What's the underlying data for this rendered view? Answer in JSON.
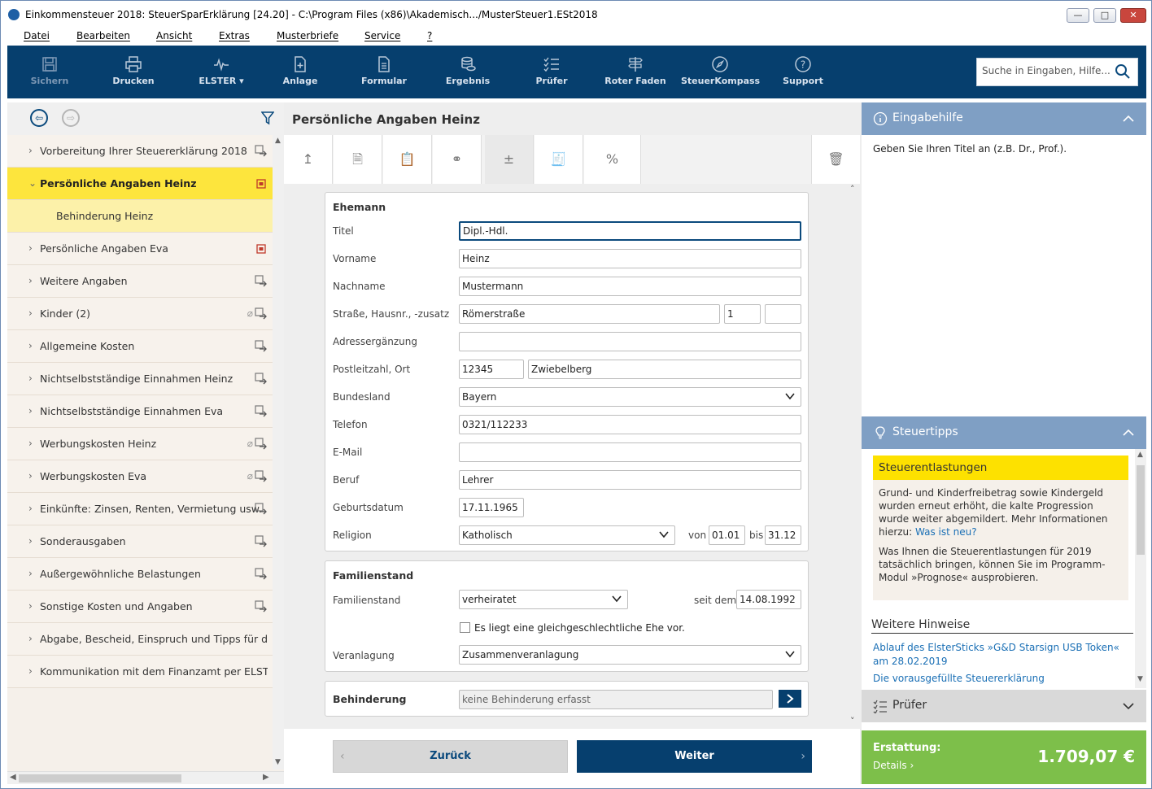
{
  "window": {
    "title": "Einkommensteuer 2018: SteuerSparErklärung [24.20] - C:\\Program Files (x86)\\Akademisch.../MusterSteuer1.ESt2018",
    "controls": {
      "minimize": "—",
      "maximize": "□",
      "close": "✕"
    }
  },
  "menu": [
    "Datei",
    "Bearbeiten",
    "Ansicht",
    "Extras",
    "Musterbriefe",
    "Service",
    "?"
  ],
  "toolbar": {
    "buttons": [
      {
        "label": "Sichern",
        "icon": "save-icon"
      },
      {
        "label": "Drucken",
        "icon": "printer-icon"
      },
      {
        "label": "ELSTER",
        "icon": "elster-icon"
      },
      {
        "label": "Anlage",
        "icon": "add-document-icon"
      },
      {
        "label": "Formular",
        "icon": "form-icon"
      },
      {
        "label": "Ergebnis",
        "icon": "coins-icon"
      },
      {
        "label": "Prüfer",
        "icon": "checklist-icon"
      },
      {
        "label": "Roter Faden",
        "icon": "signpost-icon"
      },
      {
        "label": "SteuerKompass",
        "icon": "compass-icon"
      },
      {
        "label": "Support",
        "icon": "help-icon"
      }
    ],
    "search_placeholder": "Suche in Eingaben, Hilfe..."
  },
  "nav": {
    "items": [
      {
        "label": "Vorbereitung Ihrer Steuererklärung 2018",
        "state": "collapsed"
      },
      {
        "label": "Persönliche Angaben Heinz",
        "state": "active"
      },
      {
        "label": "Behinderung Heinz",
        "state": "sub"
      },
      {
        "label": "Persönliche Angaben Eva",
        "state": "collapsed"
      },
      {
        "label": "Weitere Angaben",
        "state": "collapsed"
      },
      {
        "label": "Kinder (2)",
        "state": "collapsed",
        "attachment": true
      },
      {
        "label": "Allgemeine Kosten",
        "state": "collapsed"
      },
      {
        "label": "Nichtselbstständige Einnahmen Heinz",
        "state": "collapsed"
      },
      {
        "label": "Nichtselbstständige Einnahmen Eva",
        "state": "collapsed"
      },
      {
        "label": "Werbungskosten Heinz",
        "state": "collapsed",
        "attachment": true
      },
      {
        "label": "Werbungskosten Eva",
        "state": "collapsed",
        "attachment": true
      },
      {
        "label": "Einkünfte: Zinsen, Renten, Vermietung usw.",
        "state": "collapsed"
      },
      {
        "label": "Sonderausgaben",
        "state": "collapsed"
      },
      {
        "label": "Außergewöhnliche Belastungen",
        "state": "collapsed"
      },
      {
        "label": "Sonstige Kosten und Angaben",
        "state": "collapsed"
      },
      {
        "label": "Abgabe, Bescheid, Einspruch und Tipps für das ...",
        "state": "collapsed",
        "no_icon": true
      },
      {
        "label": "Kommunikation mit dem Finanzamt per ELSTER",
        "state": "collapsed",
        "no_icon": true
      }
    ]
  },
  "center": {
    "page_title": "Persönliche Angaben Heinz",
    "ehemann": {
      "heading": "Ehemann",
      "titel": {
        "label": "Titel",
        "value": "Dipl.-Hdl."
      },
      "vorname": {
        "label": "Vorname",
        "value": "Heinz"
      },
      "nachname": {
        "label": "Nachname",
        "value": "Mustermann"
      },
      "strasse": {
        "label": "Straße, Hausnr., -zusatz",
        "street": "Römerstraße",
        "number": "1",
        "suffix": ""
      },
      "adresse": {
        "label": "Adressergänzung",
        "value": ""
      },
      "plz": {
        "label": "Postleitzahl, Ort",
        "zip": "12345",
        "city": "Zwiebelberg"
      },
      "bundesland": {
        "label": "Bundesland",
        "value": "Bayern"
      },
      "telefon": {
        "label": "Telefon",
        "value": "0321/112233"
      },
      "email": {
        "label": "E-Mail",
        "value": ""
      },
      "beruf": {
        "label": "Beruf",
        "value": "Lehrer"
      },
      "geburtsdatum": {
        "label": "Geburtsdatum",
        "value": "17.11.1965"
      },
      "religion": {
        "label": "Religion",
        "value": "Katholisch",
        "von_label": "von",
        "von": "01.01",
        "bis_label": "bis",
        "bis": "31.12"
      }
    },
    "familienstand": {
      "heading": "Familienstand",
      "status": {
        "label": "Familienstand",
        "value": "verheiratet",
        "seit_label": "seit dem",
        "seit": "14.08.1992"
      },
      "checkbox_label": "Es liegt eine gleichgeschlechtliche Ehe vor.",
      "veranlagung": {
        "label": "Veranlagung",
        "value": "Zusammenveranlagung"
      }
    },
    "behinderung": {
      "heading": "Behinderung",
      "value": "keine Behinderung erfasst"
    },
    "back_label": "Zurück",
    "next_label": "Weiter"
  },
  "right": {
    "eingabehilfe": {
      "title": "Eingabehilfe",
      "text": "Geben Sie Ihren Titel an (z.B. Dr., Prof.)."
    },
    "steuertipps": {
      "title": "Steuertipps",
      "card_title": "Steuerentlastungen",
      "p1": "Grund- und Kinderfreibetrag sowie Kindergeld wurden erneut erhöht, die kalte Progression wurde weiter abgemildert. Mehr Informationen hierzu:",
      "p1_link": "Was ist neu?",
      "p2": "Was Ihnen die Steuerentlastungen für 2019 tatsächlich bringen, können Sie im Programm-Modul »Prognose« ausprobieren.",
      "weitere_title": "Weitere Hinweise",
      "links": [
        "Ablauf des ElsterSticks »G&D Starsign USB Token« am 28.02.2019",
        "Die vorausgefüllte Steuererklärung"
      ]
    },
    "pruefer": {
      "title": "Prüfer"
    },
    "refund": {
      "label": "Erstattung:",
      "details": "Details",
      "amount": "1.709,07 €"
    }
  },
  "colors": {
    "toolbar": "#063f6e",
    "active_nav": "#fde53d",
    "panel_head": "#7f9fc4",
    "refund": "#7dbf4a"
  }
}
